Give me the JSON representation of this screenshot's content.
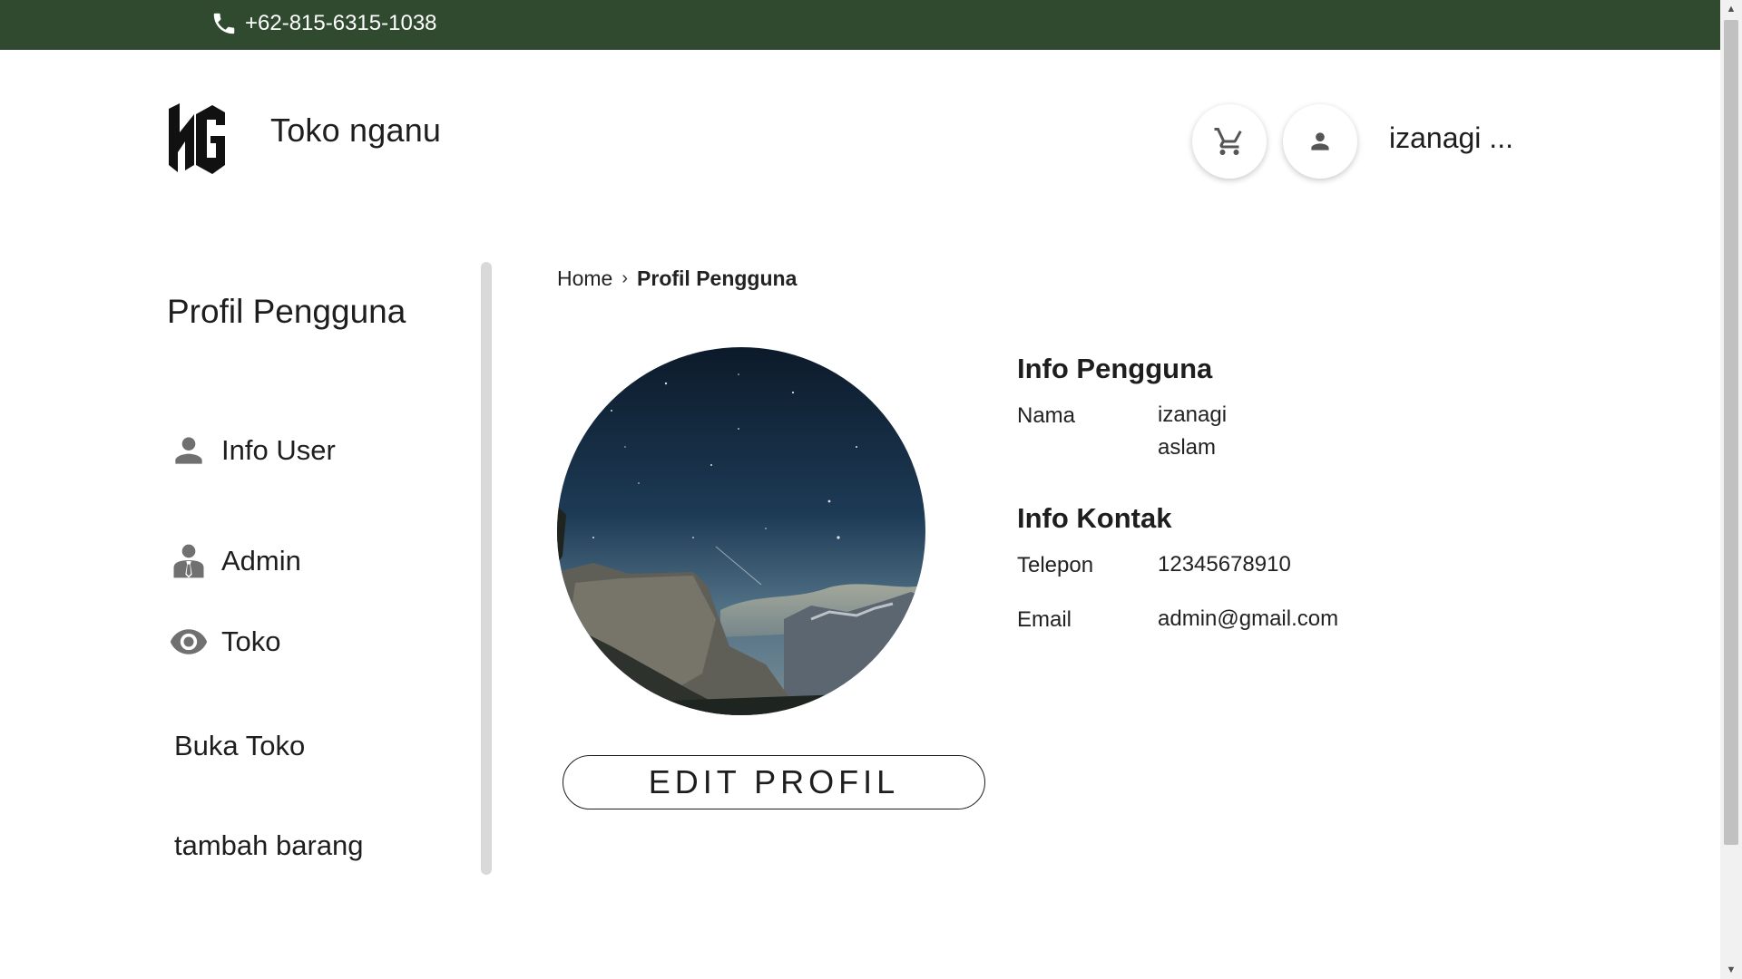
{
  "topbar": {
    "phone": "+62-815-6315-1038",
    "phone_icon": "phone-icon",
    "bg_color": "#2f4a2e"
  },
  "header": {
    "store_name": "Toko nganu",
    "logo_text": "NG",
    "cart_icon": "cart-icon",
    "account_icon": "person-icon",
    "username": "izanagi ..."
  },
  "sidebar": {
    "title": "Profil Pengguna",
    "items": [
      {
        "label": "Info User",
        "icon": "person-icon"
      },
      {
        "label": "Admin",
        "icon": "admin-icon"
      },
      {
        "label": "Toko",
        "icon": "eye-icon"
      }
    ],
    "links": [
      {
        "label": "Buka Toko"
      },
      {
        "label": "tambah barang"
      }
    ]
  },
  "breadcrumb": {
    "home": "Home",
    "separator": "›",
    "current": "Profil Pengguna"
  },
  "profile": {
    "edit_button": "EDIT PROFIL",
    "user_info_heading": "Info Pengguna",
    "name_label": "Nama",
    "name_value": "izanagi aslam",
    "contact_heading": "Info Kontak",
    "phone_label": "Telepon",
    "phone_value": "12345678910",
    "email_label": "Email",
    "email_value": "admin@gmail.com"
  }
}
